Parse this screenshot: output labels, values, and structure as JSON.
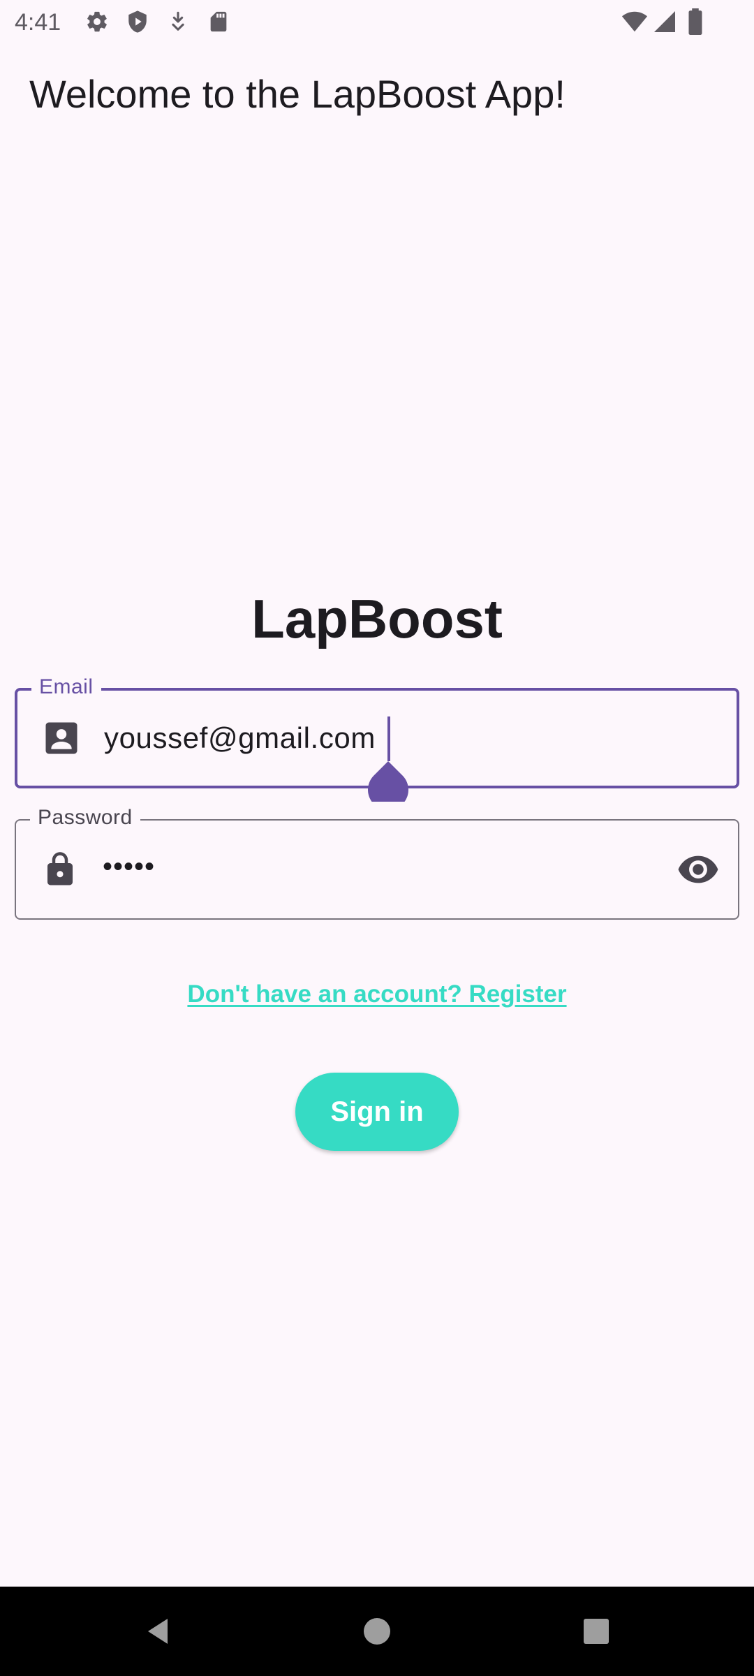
{
  "status_bar": {
    "time": "4:41",
    "icons_left": [
      "gear-icon",
      "shield-play-icon",
      "download-icon",
      "sd-card-icon"
    ],
    "icons_right": [
      "wifi-icon",
      "signal-icon",
      "battery-icon"
    ]
  },
  "header": {
    "welcome_text": "Welcome to the LapBoost App!"
  },
  "login": {
    "app_title": "LapBoost",
    "email": {
      "label": "Email",
      "value": "youssef@gmail.com",
      "icon": "contact-card-icon"
    },
    "password": {
      "label": "Password",
      "value": "•••••",
      "icon": "lock-icon",
      "toggle_icon": "eye-icon"
    },
    "register_link": "Don't have an account? Register",
    "sign_in_label": "Sign in"
  },
  "colors": {
    "background": "#FDF7FC",
    "primary": "#6750A4",
    "accent": "#36DBC4",
    "text": "#1D1B20",
    "outline": "#79747E"
  },
  "nav_bar": {
    "buttons": [
      "back-icon",
      "home-icon",
      "recents-icon"
    ]
  }
}
